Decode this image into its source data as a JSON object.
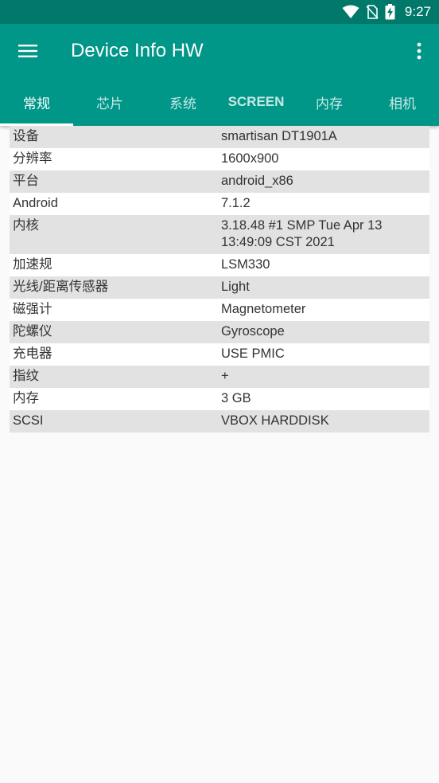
{
  "status_bar": {
    "time": "9:27",
    "icons": [
      "wifi-icon",
      "no-sim-icon",
      "battery-charging-icon"
    ]
  },
  "app_bar": {
    "title": "Device Info HW",
    "menu_icon": "hamburger-menu-icon",
    "overflow_icon": "more-vert-icon",
    "background": "#009688",
    "status_background": "#00796b"
  },
  "tabs": [
    {
      "label": "常规",
      "active": true
    },
    {
      "label": "芯片",
      "active": false
    },
    {
      "label": "系统",
      "active": false
    },
    {
      "label": "SCREEN",
      "active": false
    },
    {
      "label": "内存",
      "active": false
    },
    {
      "label": "相机",
      "active": false
    }
  ],
  "rows": [
    {
      "label": "设备",
      "value": "smartisan DT1901A"
    },
    {
      "label": "分辨率",
      "value": "1600x900"
    },
    {
      "label": "平台",
      "value": "android_x86"
    },
    {
      "label": "Android",
      "value": "7.1.2"
    },
    {
      "label": "内核",
      "value": "3.18.48 #1 SMP Tue Apr 13 13:49:09 CST 2021"
    },
    {
      "label": "加速规",
      "value": "LSM330"
    },
    {
      "label": "光线/距离传感器",
      "value": "Light"
    },
    {
      "label": "磁强计",
      "value": "Magnetometer"
    },
    {
      "label": "陀螺仪",
      "value": "Gyroscope"
    },
    {
      "label": "充电器",
      "value": "USE PMIC"
    },
    {
      "label": "指纹",
      "value": "+"
    },
    {
      "label": "内存",
      "value": "3 GB"
    },
    {
      "label": "SCSI",
      "value": "VBOX HARDDISK"
    }
  ]
}
